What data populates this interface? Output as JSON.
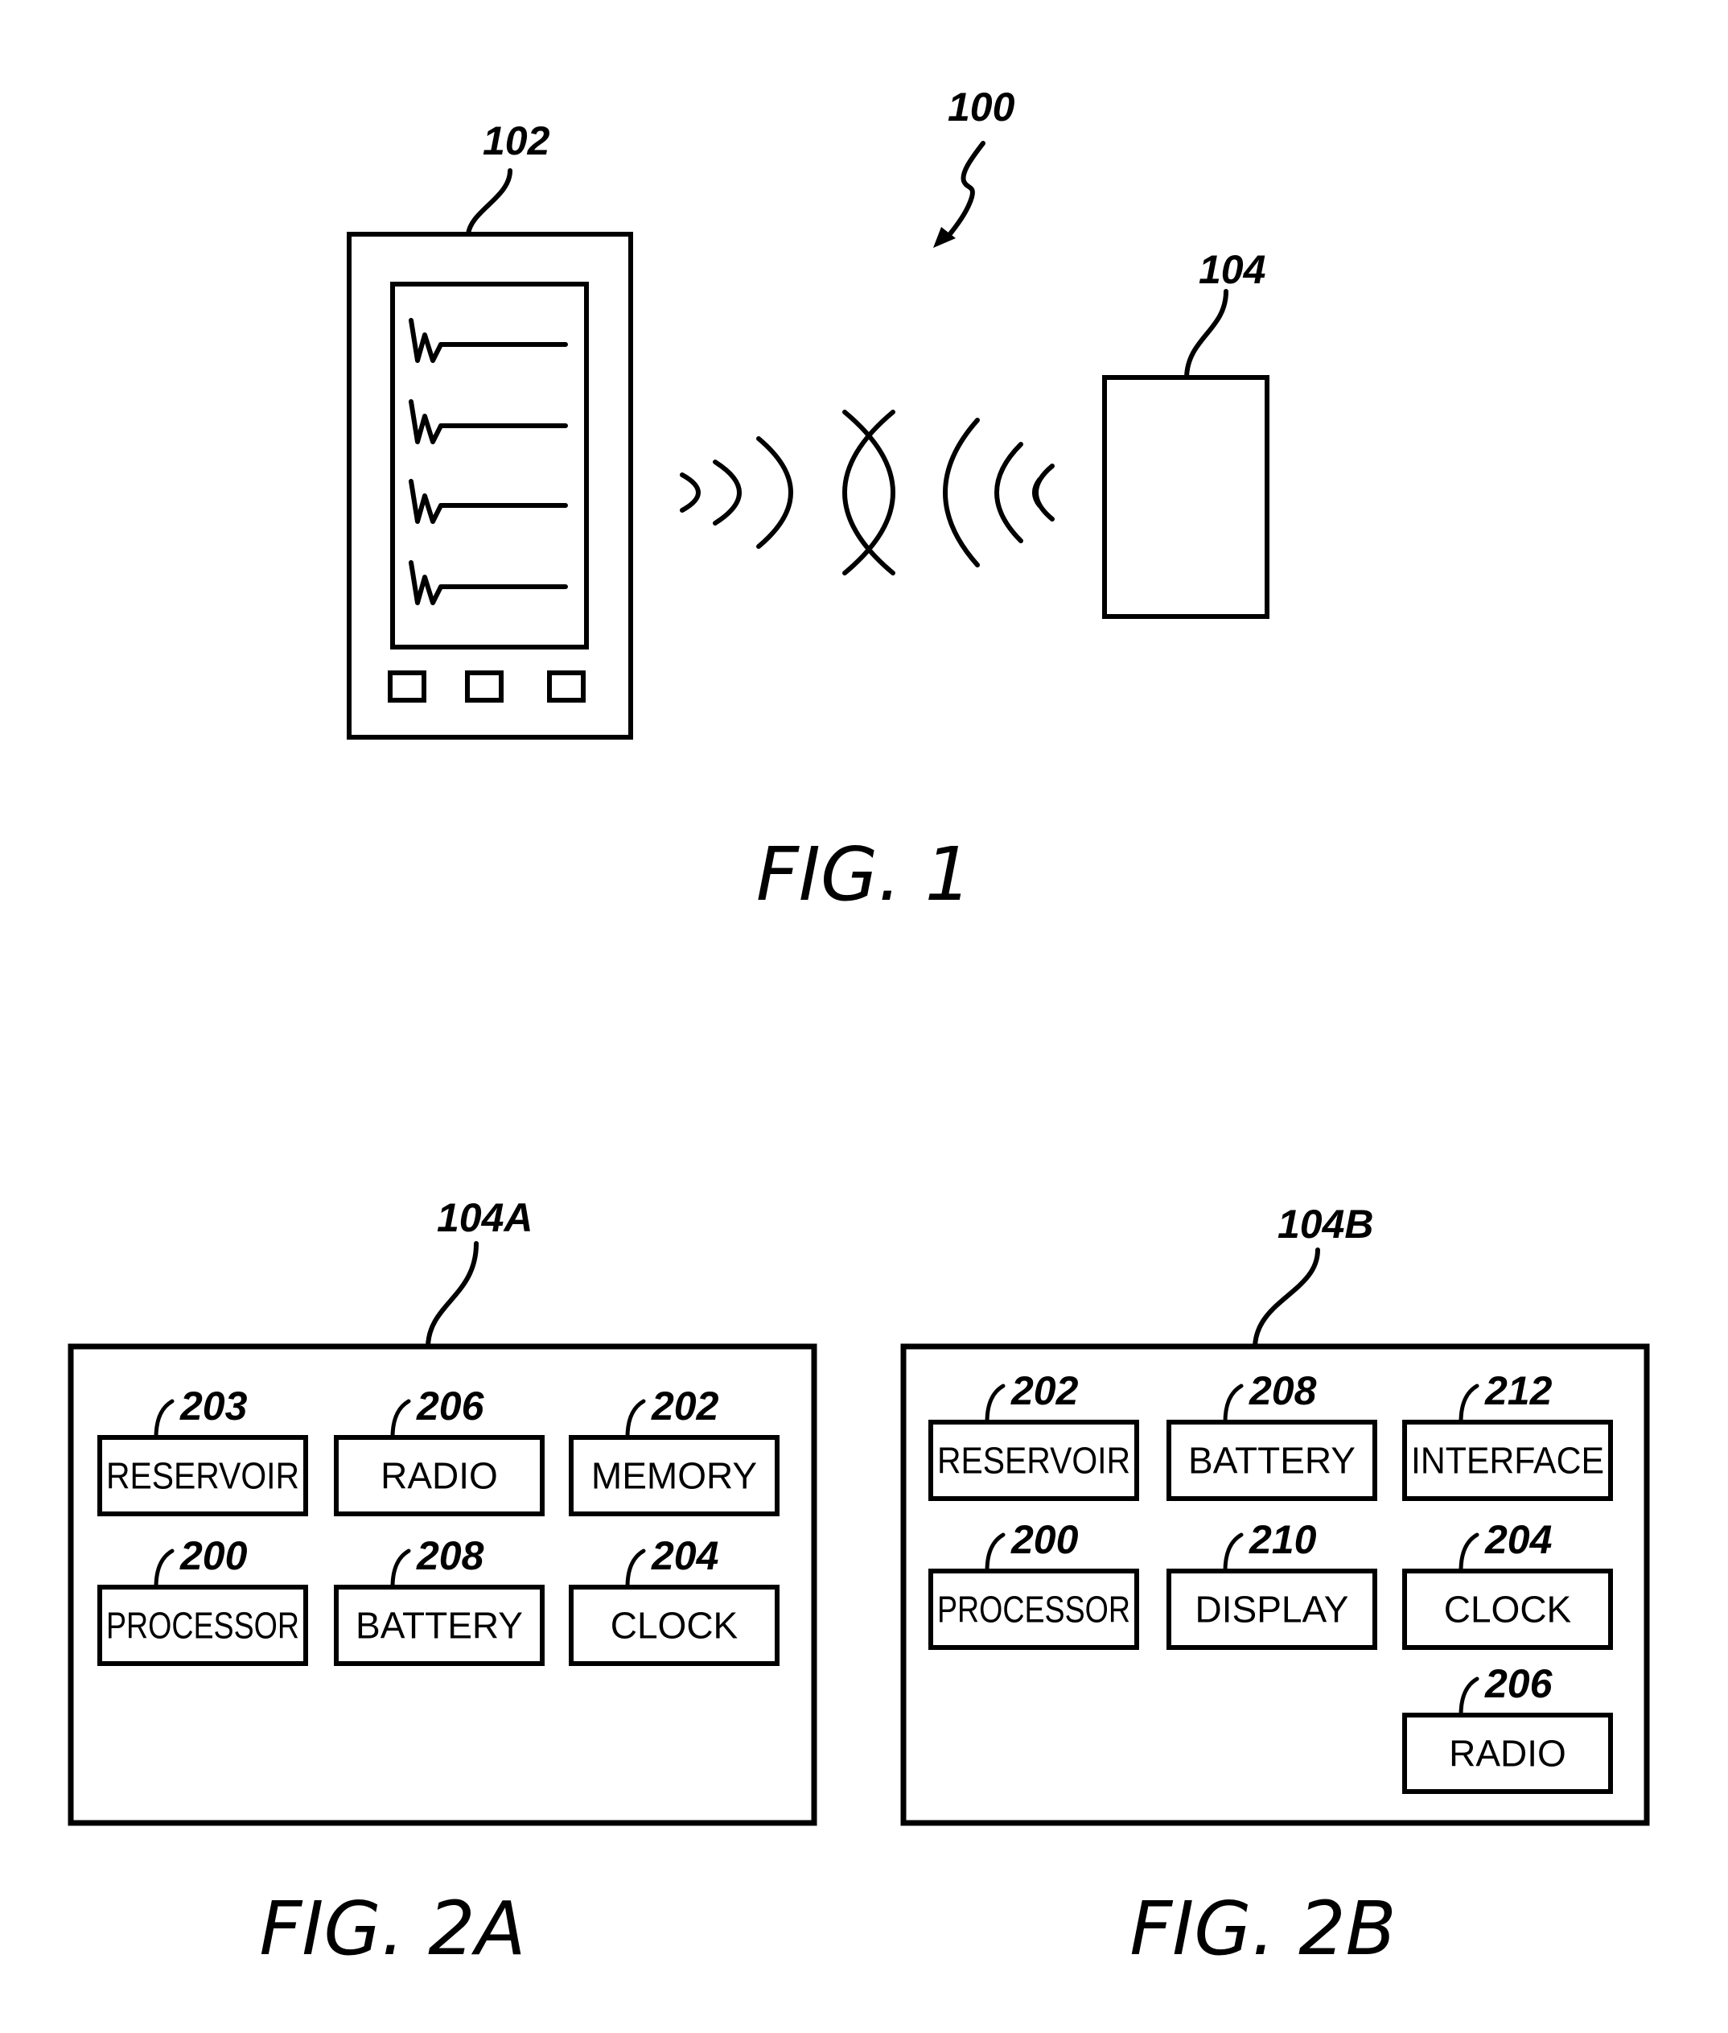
{
  "fig1": {
    "caption": "FIG.  1",
    "system_ref": "100",
    "phone": {
      "ref": "102",
      "list_rows": 4,
      "buttons": 3
    },
    "device": {
      "ref": "104"
    }
  },
  "fig2a": {
    "caption": "FIG.  2A",
    "device_ref": "104A",
    "components": [
      {
        "ref": "203",
        "label": "RESERVOIR"
      },
      {
        "ref": "206",
        "label": "RADIO"
      },
      {
        "ref": "202",
        "label": "MEMORY"
      },
      {
        "ref": "200",
        "label": "PROCESSOR"
      },
      {
        "ref": "208",
        "label": "BATTERY"
      },
      {
        "ref": "204",
        "label": "CLOCK"
      }
    ]
  },
  "fig2b": {
    "caption": "FIG.  2B",
    "device_ref": "104B",
    "components": [
      {
        "ref": "202",
        "label": "RESERVOIR"
      },
      {
        "ref": "208",
        "label": "BATTERY"
      },
      {
        "ref": "212",
        "label": "INTERFACE"
      },
      {
        "ref": "200",
        "label": "PROCESSOR"
      },
      {
        "ref": "210",
        "label": "DISPLAY"
      },
      {
        "ref": "204",
        "label": "CLOCK"
      },
      {
        "ref": "206",
        "label": "RADIO"
      }
    ]
  }
}
